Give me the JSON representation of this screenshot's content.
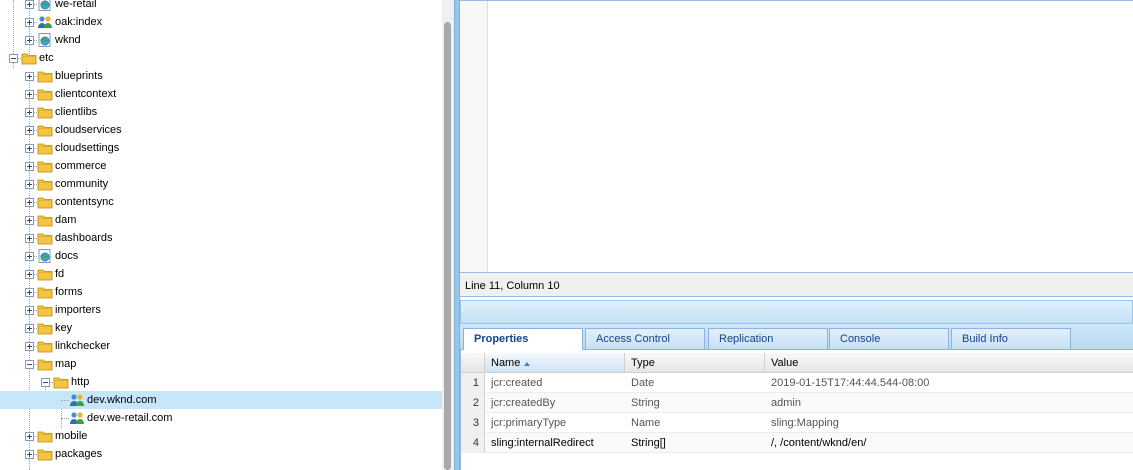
{
  "tree": {
    "nodes": [
      {
        "label": "we-retail",
        "icon": "page-globe-icon",
        "expander": "plus"
      },
      {
        "label": "oak:index",
        "icon": "users-node-icon",
        "expander": "plus"
      },
      {
        "label": "wknd",
        "icon": "page-globe-icon",
        "expander": "plus"
      },
      {
        "label": "etc",
        "icon": "folder-icon",
        "expander": "minus"
      },
      {
        "label": "blueprints",
        "icon": "folder-icon",
        "expander": "plus"
      },
      {
        "label": "clientcontext",
        "icon": "folder-icon",
        "expander": "plus"
      },
      {
        "label": "clientlibs",
        "icon": "folder-icon",
        "expander": "plus"
      },
      {
        "label": "cloudservices",
        "icon": "folder-icon",
        "expander": "plus"
      },
      {
        "label": "cloudsettings",
        "icon": "folder-icon",
        "expander": "plus"
      },
      {
        "label": "commerce",
        "icon": "folder-icon",
        "expander": "plus"
      },
      {
        "label": "community",
        "icon": "folder-icon",
        "expander": "plus"
      },
      {
        "label": "contentsync",
        "icon": "folder-icon",
        "expander": "plus"
      },
      {
        "label": "dam",
        "icon": "folder-icon",
        "expander": "plus"
      },
      {
        "label": "dashboards",
        "icon": "folder-icon",
        "expander": "plus"
      },
      {
        "label": "docs",
        "icon": "page-globe-icon",
        "expander": "plus"
      },
      {
        "label": "fd",
        "icon": "folder-icon",
        "expander": "plus"
      },
      {
        "label": "forms",
        "icon": "folder-icon",
        "expander": "plus"
      },
      {
        "label": "importers",
        "icon": "folder-icon",
        "expander": "plus"
      },
      {
        "label": "key",
        "icon": "folder-icon",
        "expander": "plus"
      },
      {
        "label": "linkchecker",
        "icon": "folder-icon",
        "expander": "plus"
      },
      {
        "label": "map",
        "icon": "folder-icon",
        "expander": "minus"
      },
      {
        "label": "http",
        "icon": "folder-icon",
        "expander": "minus"
      },
      {
        "label": "dev.wknd.com",
        "icon": "users-node-icon",
        "expander": "none"
      },
      {
        "label": "dev.we-retail.com",
        "icon": "users-node-icon",
        "expander": "none"
      },
      {
        "label": "mobile",
        "icon": "folder-icon",
        "expander": "plus"
      },
      {
        "label": "packages",
        "icon": "folder-icon",
        "expander": "plus"
      }
    ],
    "selected": "dev.wknd.com"
  },
  "editor": {
    "status": "Line 11, Column 10"
  },
  "tabs": [
    {
      "label": "Properties",
      "active": true
    },
    {
      "label": "Access Control",
      "active": false
    },
    {
      "label": "Replication",
      "active": false
    },
    {
      "label": "Console",
      "active": false
    },
    {
      "label": "Build Info",
      "active": false
    }
  ],
  "grid": {
    "columns": [
      "Name",
      "Type",
      "Value"
    ],
    "sorted_column": "Name",
    "rows": [
      {
        "num": "1",
        "name": "jcr:created",
        "type": "Date",
        "value": "2019-01-15T17:44:44.544-08:00"
      },
      {
        "num": "2",
        "name": "jcr:createdBy",
        "type": "String",
        "value": "admin"
      },
      {
        "num": "3",
        "name": "jcr:primaryType",
        "type": "Name",
        "value": "sling:Mapping"
      },
      {
        "num": "4",
        "name": "sling:internalRedirect",
        "type": "String[]",
        "value": "/, /content/wknd/en/"
      }
    ]
  },
  "colors": {
    "selection": "#c6e6fb",
    "folder": "#f5c542",
    "tab_text": "#15428b",
    "border_blue": "#99bbe8"
  }
}
